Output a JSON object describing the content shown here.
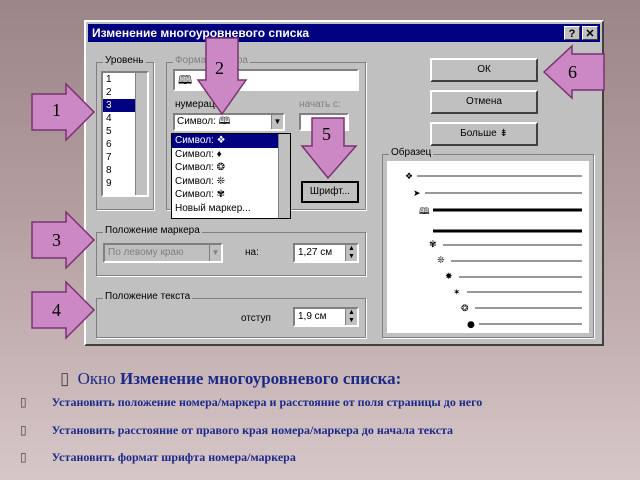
{
  "window": {
    "title": "Изменение многоуровневого списка",
    "help_label": "?",
    "close_label": "✕"
  },
  "level": {
    "label": "Уровень",
    "items": [
      "1",
      "2",
      "3",
      "4",
      "5",
      "6",
      "7",
      "8",
      "9"
    ],
    "selected": "3"
  },
  "format": {
    "label": "Формат номера",
    "number_value": "🕮",
    "numbering_label": "нумерация:",
    "numbering_value": "Символ: 🕮",
    "start_label": "начать с:",
    "font_button": "Шрифт...",
    "dropdown_items": [
      "Символ: ❖",
      "Символ: ♦",
      "Символ: ❂",
      "Символ: ❊",
      "Символ: ✾",
      "Новый маркер..."
    ]
  },
  "buttons": {
    "ok": "ОК",
    "cancel": "Отмена",
    "more": "Больше ⇟"
  },
  "preview": {
    "label": "Образец"
  },
  "marker_position": {
    "label": "Положение маркера",
    "align_value": "По левому краю",
    "at_label": "на:",
    "at_value": "1,27 см"
  },
  "text_position": {
    "label": "Положение текста",
    "indent_label": "отступ",
    "indent_value": "1,9 см"
  },
  "callouts": [
    "1",
    "2",
    "3",
    "4",
    "5",
    "6"
  ],
  "caption": {
    "prefix": "Окно",
    "title": "Изменение многоуровневого списка:"
  },
  "bullets": [
    "Установить положение номера/маркера и расстояние от поля страницы до него",
    "Установить расстояние от правого края номера/маркера до начала текста",
    "Установить формат шрифта номера/маркера"
  ],
  "colors": {
    "callout_fill": "#cc88c4",
    "callout_dark": "#8e3d85",
    "caption_blue": "#1b2a8a"
  }
}
